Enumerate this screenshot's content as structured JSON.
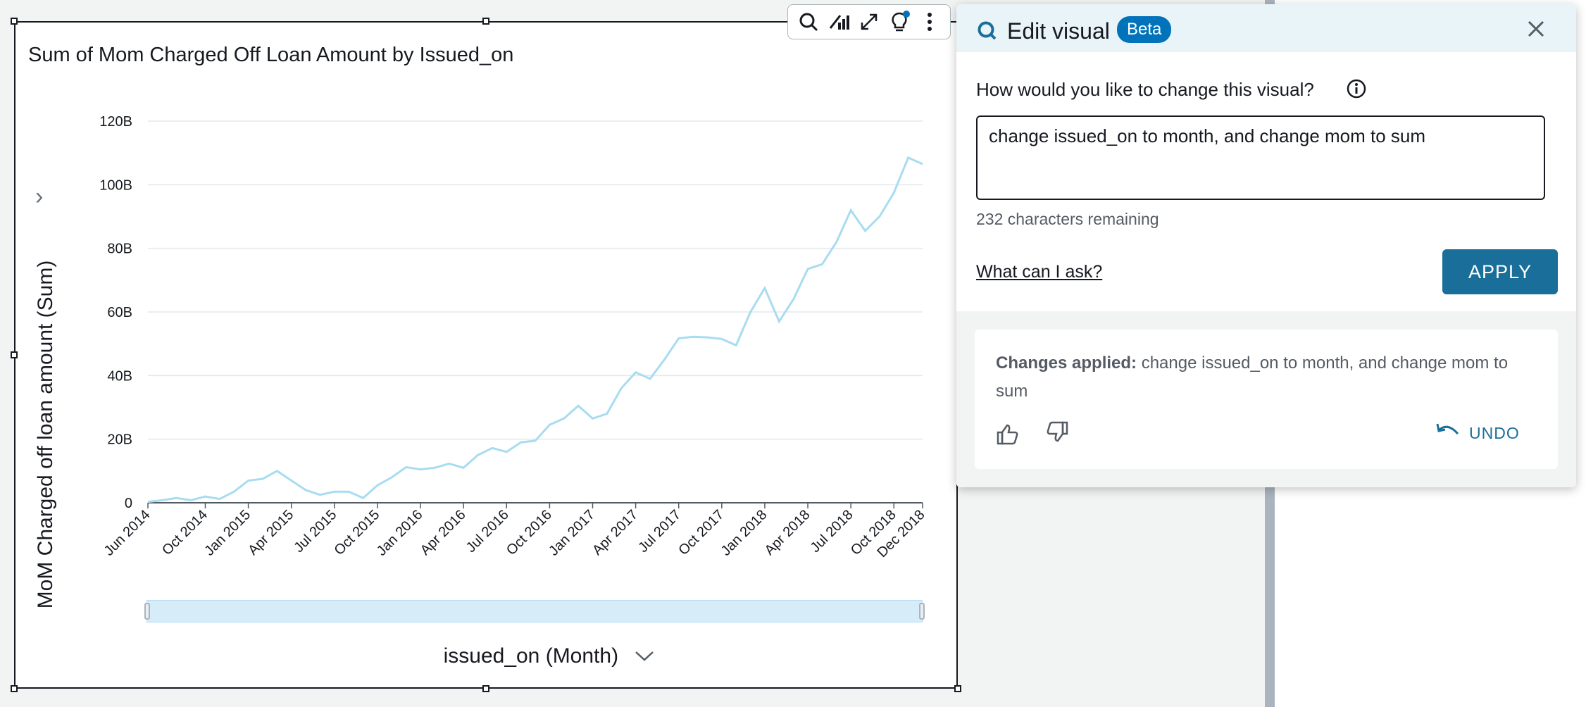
{
  "visual": {
    "title": "Sum of Mom Charged Off Loan Amount by Issued_on",
    "y_axis_title": "MoM Charged off loan amount (Sum)",
    "x_axis_title": "issued_on (Month)"
  },
  "toolbar": {
    "icons": [
      "search-icon",
      "analyze-icon",
      "expand-icon",
      "lightbulb-icon",
      "more-menu-icon"
    ]
  },
  "edit_panel": {
    "title": "Edit visual",
    "badge": "Beta",
    "question_label": "How would you like to change this visual?",
    "prompt_value": "change issued_on to month, and change mom to sum",
    "chars_remaining": "232 characters remaining",
    "help_link": "What can I ask?",
    "apply_label": "APPLY",
    "changes_prefix": "Changes applied:",
    "changes_text": "change issued_on to month, and change mom to sum",
    "undo_label": "UNDO"
  },
  "colors": {
    "line": "#a8dcf0",
    "accent": "#0073bb",
    "apply": "#1a6f9a",
    "header_bg": "#e9f4f8"
  },
  "chart_data": {
    "type": "line",
    "title": "Sum of Mom Charged Off Loan Amount by Issued_on",
    "xlabel": "issued_on (Month)",
    "ylabel": "MoM Charged off loan amount (Sum)",
    "ylim": [
      0,
      120
    ],
    "y_ticks": [
      "0",
      "20B",
      "40B",
      "60B",
      "80B",
      "100B",
      "120B"
    ],
    "y_tick_values": [
      0,
      20,
      40,
      60,
      80,
      100,
      120
    ],
    "x_tick_labels": [
      "Jun 2014",
      "Oct 2014",
      "Jan 2015",
      "Apr 2015",
      "Jul 2015",
      "Oct 2015",
      "Jan 2016",
      "Apr 2016",
      "Jul 2016",
      "Oct 2016",
      "Jan 2017",
      "Apr 2017",
      "Jul 2017",
      "Oct 2017",
      "Jan 2018",
      "Apr 2018",
      "Jul 2018",
      "Oct 2018",
      "Dec 2018"
    ],
    "x_tick_index": [
      0,
      4,
      7,
      10,
      13,
      16,
      19,
      22,
      25,
      28,
      31,
      34,
      37,
      40,
      43,
      46,
      49,
      52,
      54
    ],
    "grid": true,
    "series": [
      {
        "values": [
          0.3,
          0.8,
          1.5,
          0.8,
          2.0,
          1.2,
          3.5,
          7.0,
          7.5,
          10.0,
          7.0,
          4.0,
          2.5,
          3.5,
          3.5,
          1.5,
          5.5,
          8.0,
          11.2,
          10.5,
          11.0,
          12.3,
          11.0,
          15.0,
          17.2,
          16.0,
          19.0,
          19.5,
          24.5,
          26.5,
          30.5,
          26.5,
          28.0,
          36.0,
          41.0,
          39.0,
          45.0,
          51.7,
          52.2,
          52.0,
          51.5,
          49.5,
          60.0,
          67.5,
          57.0,
          64.0,
          73.5,
          75.0,
          82.0,
          92.0,
          85.5,
          90.0,
          97.5,
          108.5,
          106.5
        ]
      }
    ]
  }
}
